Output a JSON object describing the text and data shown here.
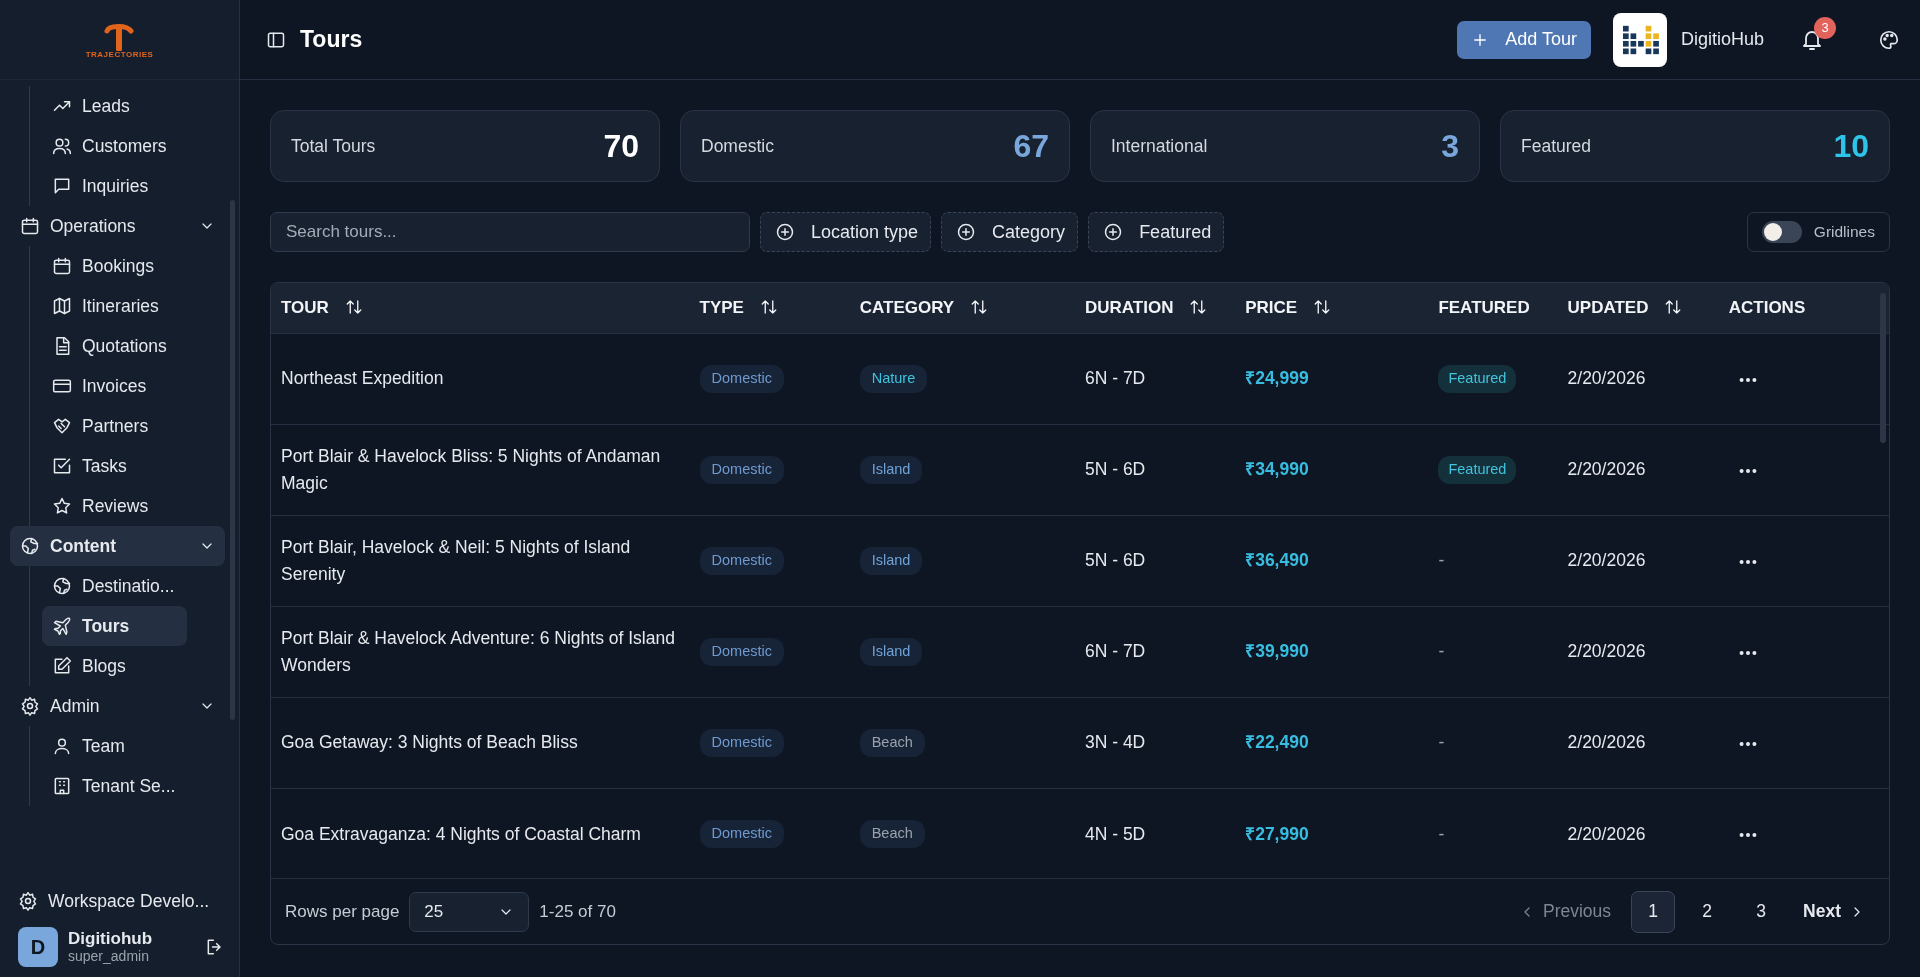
{
  "sidebar": {
    "logo_text": "TRAJECTORIES",
    "groups": [
      {
        "items": [
          {
            "label": "Leads",
            "selected": false
          },
          {
            "label": "Customers",
            "selected": false
          },
          {
            "label": "Inquiries",
            "selected": false
          }
        ]
      },
      {
        "label": "Operations",
        "expanded": true,
        "selected": false,
        "items": [
          {
            "label": "Bookings",
            "selected": false
          },
          {
            "label": "Itineraries",
            "selected": false
          },
          {
            "label": "Quotations",
            "selected": false
          },
          {
            "label": "Invoices",
            "selected": false
          },
          {
            "label": "Partners",
            "selected": false
          },
          {
            "label": "Tasks",
            "selected": false
          },
          {
            "label": "Reviews",
            "selected": false
          }
        ]
      },
      {
        "label": "Content",
        "expanded": true,
        "selected": true,
        "items": [
          {
            "label": "Destinatio...",
            "selected": false
          },
          {
            "label": "Tours",
            "selected": true
          },
          {
            "label": "Blogs",
            "selected": false
          }
        ]
      },
      {
        "label": "Admin",
        "expanded": true,
        "selected": false,
        "items": [
          {
            "label": "Team",
            "selected": false
          },
          {
            "label": "Tenant Se...",
            "selected": false
          }
        ]
      }
    ],
    "workspace": "Workspace Develo...",
    "user": {
      "initial": "D",
      "name": "Digitiohub",
      "role": "super_admin"
    }
  },
  "header": {
    "title": "Tours",
    "add_button": "Add Tour",
    "org_name": "DigitioHub",
    "notifications": "3"
  },
  "stats": [
    {
      "label": "Total Tours",
      "value": "70",
      "color": "#ffffff"
    },
    {
      "label": "Domestic",
      "value": "67",
      "color": "#7aa7db"
    },
    {
      "label": "International",
      "value": "3",
      "color": "#7aa7db"
    },
    {
      "label": "Featured",
      "value": "10",
      "color": "#2ec4ea"
    }
  ],
  "filters": {
    "search": {
      "placeholder": "Search tours..."
    },
    "buttons": [
      "Location type",
      "Category",
      "Featured"
    ],
    "gridlines": {
      "label": "Gridlines",
      "on": false
    }
  },
  "table": {
    "columns": [
      {
        "label": "TOUR",
        "sortable": true
      },
      {
        "label": "TYPE",
        "sortable": true
      },
      {
        "label": "CATEGORY",
        "sortable": true
      },
      {
        "label": "DURATION",
        "sortable": true
      },
      {
        "label": "PRICE",
        "sortable": true
      },
      {
        "label": "FEATURED",
        "sortable": false
      },
      {
        "label": "UPDATED",
        "sortable": true
      },
      {
        "label": "ACTIONS",
        "sortable": false
      }
    ],
    "rows": [
      {
        "tour": "Northeast Expedition",
        "type": "Domestic",
        "category": "Nature",
        "color": "#3cc5e0",
        "duration": "6N - 7D",
        "price": "₹24,999",
        "featured": true,
        "featured_label": "Featured",
        "updated": "2/20/2026"
      },
      {
        "tour": "Port Blair & Havelock Bliss: 5 Nights of Andaman Magic",
        "type": "Domestic",
        "category": "Island",
        "color": "#6fa3d8",
        "duration": "5N - 6D",
        "price": "₹34,990",
        "featured": true,
        "featured_label": "Featured",
        "updated": "2/20/2026"
      },
      {
        "tour": "Port Blair, Havelock & Neil: 5 Nights of Island Serenity",
        "type": "Domestic",
        "category": "Island",
        "color": "#6fa3d8",
        "duration": "5N - 6D",
        "price": "₹36,490",
        "featured": false,
        "featured_label": "-",
        "updated": "2/20/2026"
      },
      {
        "tour": "Port Blair & Havelock Adventure: 6 Nights of Island Wonders",
        "type": "Domestic",
        "category": "Island",
        "color": "#6fa3d8",
        "duration": "6N - 7D",
        "price": "₹39,990",
        "featured": false,
        "featured_label": "-",
        "updated": "2/20/2026"
      },
      {
        "tour": "Goa Getaway: 3 Nights of Beach Bliss",
        "type": "Domestic",
        "category": "Beach",
        "color": "#9aa3ad",
        "duration": "3N - 4D",
        "price": "₹22,490",
        "featured": false,
        "featured_label": "-",
        "updated": "2/20/2026"
      },
      {
        "tour": "Goa Extravaganza: 4 Nights of Coastal Charm",
        "type": "Domestic",
        "category": "Beach",
        "color": "#9aa3ad",
        "duration": "4N - 5D",
        "price": "₹27,990",
        "featured": false,
        "featured_label": "-",
        "updated": "2/20/2026"
      }
    ]
  },
  "pagination": {
    "rows_label": "Rows per page",
    "page_size": "25",
    "range": "1-25 of 70",
    "previous": {
      "label": "Previous",
      "disabled": true
    },
    "pages": [
      {
        "label": "1",
        "selected": true
      },
      {
        "label": "2",
        "selected": false
      },
      {
        "label": "3",
        "selected": false
      }
    ],
    "next": {
      "label": "Next",
      "disabled": false
    }
  }
}
